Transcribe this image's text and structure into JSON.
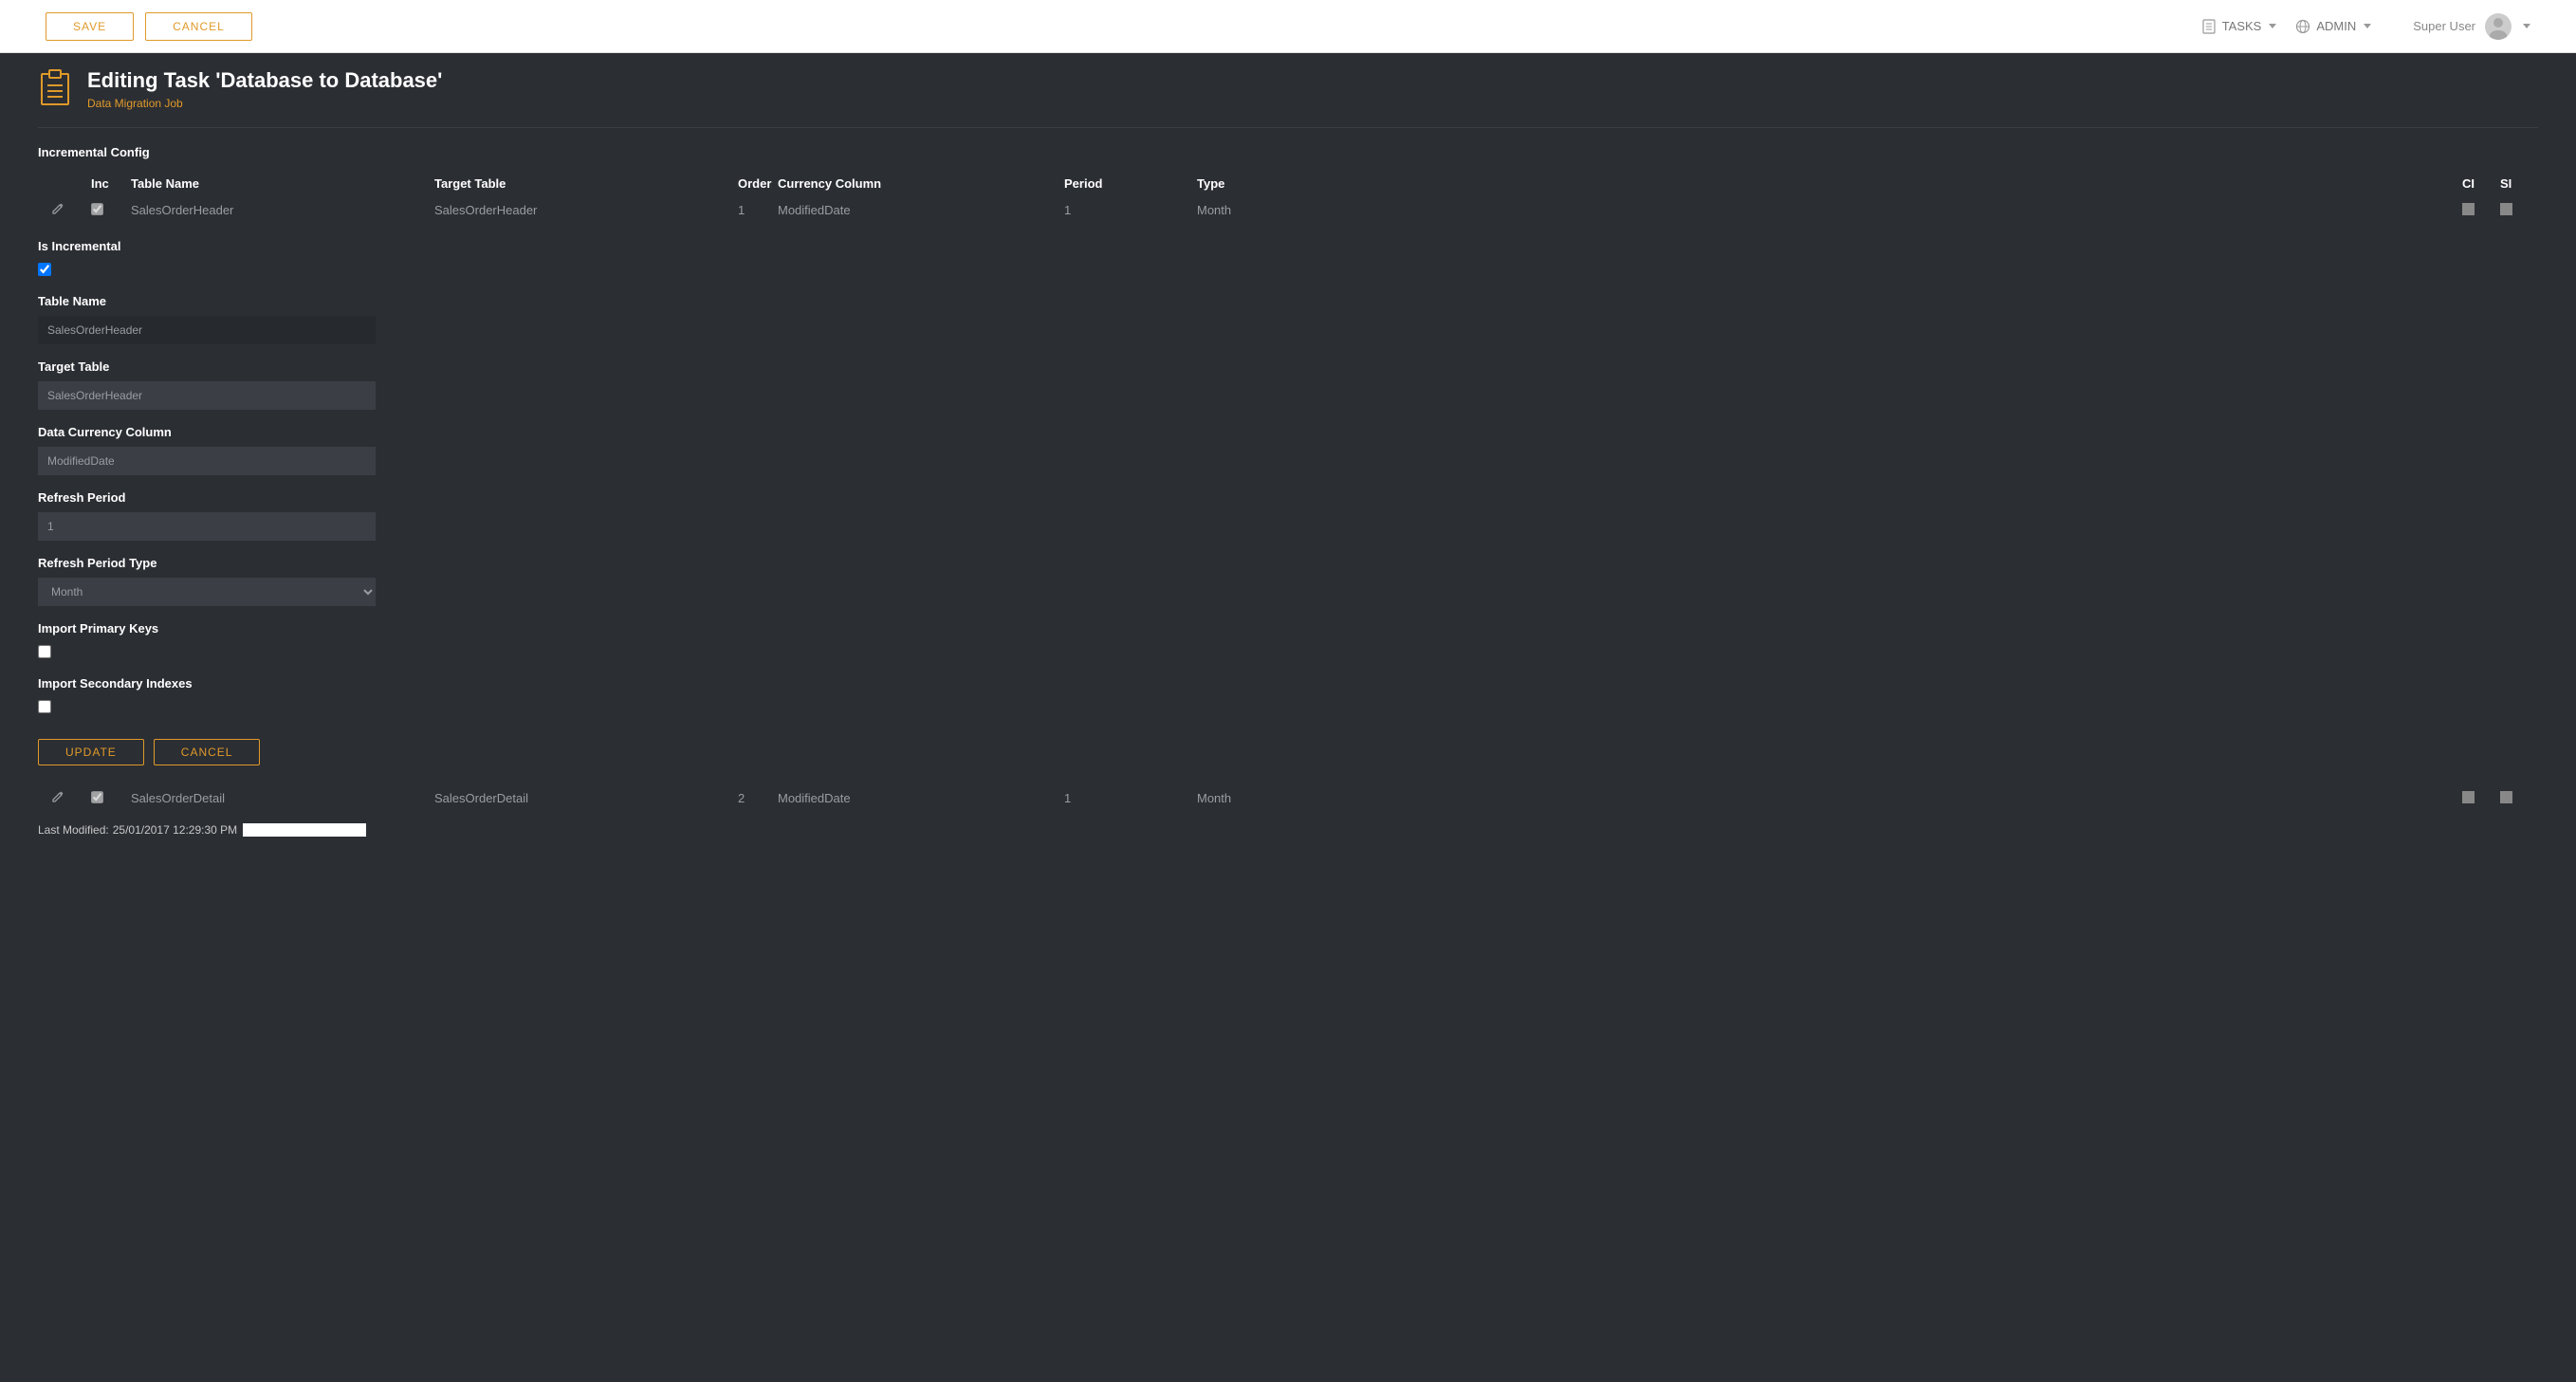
{
  "topbar": {
    "save_label": "SAVE",
    "cancel_label": "CANCEL",
    "tasks_label": "TASKS",
    "admin_label": "ADMIN",
    "user_name": "Super User"
  },
  "header": {
    "title": "Editing Task 'Database to Database'",
    "subtitle": "Data Migration Job"
  },
  "section": {
    "incremental_config": "Incremental Config"
  },
  "table": {
    "headers": {
      "inc": "Inc",
      "table_name": "Table Name",
      "target_table": "Target Table",
      "order": "Order",
      "currency": "Currency Column",
      "period": "Period",
      "type": "Type",
      "ci": "CI",
      "si": "SI"
    },
    "rows": [
      {
        "inc": true,
        "table_name": "SalesOrderHeader",
        "target_table": "SalesOrderHeader",
        "order": "1",
        "currency": "ModifiedDate",
        "period": "1",
        "type": "Month",
        "ci": false,
        "si": false
      },
      {
        "inc": true,
        "table_name": "SalesOrderDetail",
        "target_table": "SalesOrderDetail",
        "order": "2",
        "currency": "ModifiedDate",
        "period": "1",
        "type": "Month",
        "ci": false,
        "si": false
      }
    ]
  },
  "form": {
    "labels": {
      "is_incremental": "Is Incremental",
      "table_name": "Table Name",
      "target_table": "Target Table",
      "data_currency_column": "Data Currency Column",
      "refresh_period": "Refresh Period",
      "refresh_period_type": "Refresh Period Type",
      "import_primary_keys": "Import Primary Keys",
      "import_secondary_indexes": "Import Secondary Indexes"
    },
    "values": {
      "is_incremental": true,
      "table_name": "SalesOrderHeader",
      "target_table": "SalesOrderHeader",
      "data_currency_column": "ModifiedDate",
      "refresh_period": "1",
      "refresh_period_type": "Month",
      "import_primary_keys": false,
      "import_secondary_indexes": false
    },
    "actions": {
      "update": "UPDATE",
      "cancel": "CANCEL"
    }
  },
  "footer": {
    "last_modified_label": "Last Modified:",
    "last_modified_value": "25/01/2017 12:29:30 PM"
  }
}
